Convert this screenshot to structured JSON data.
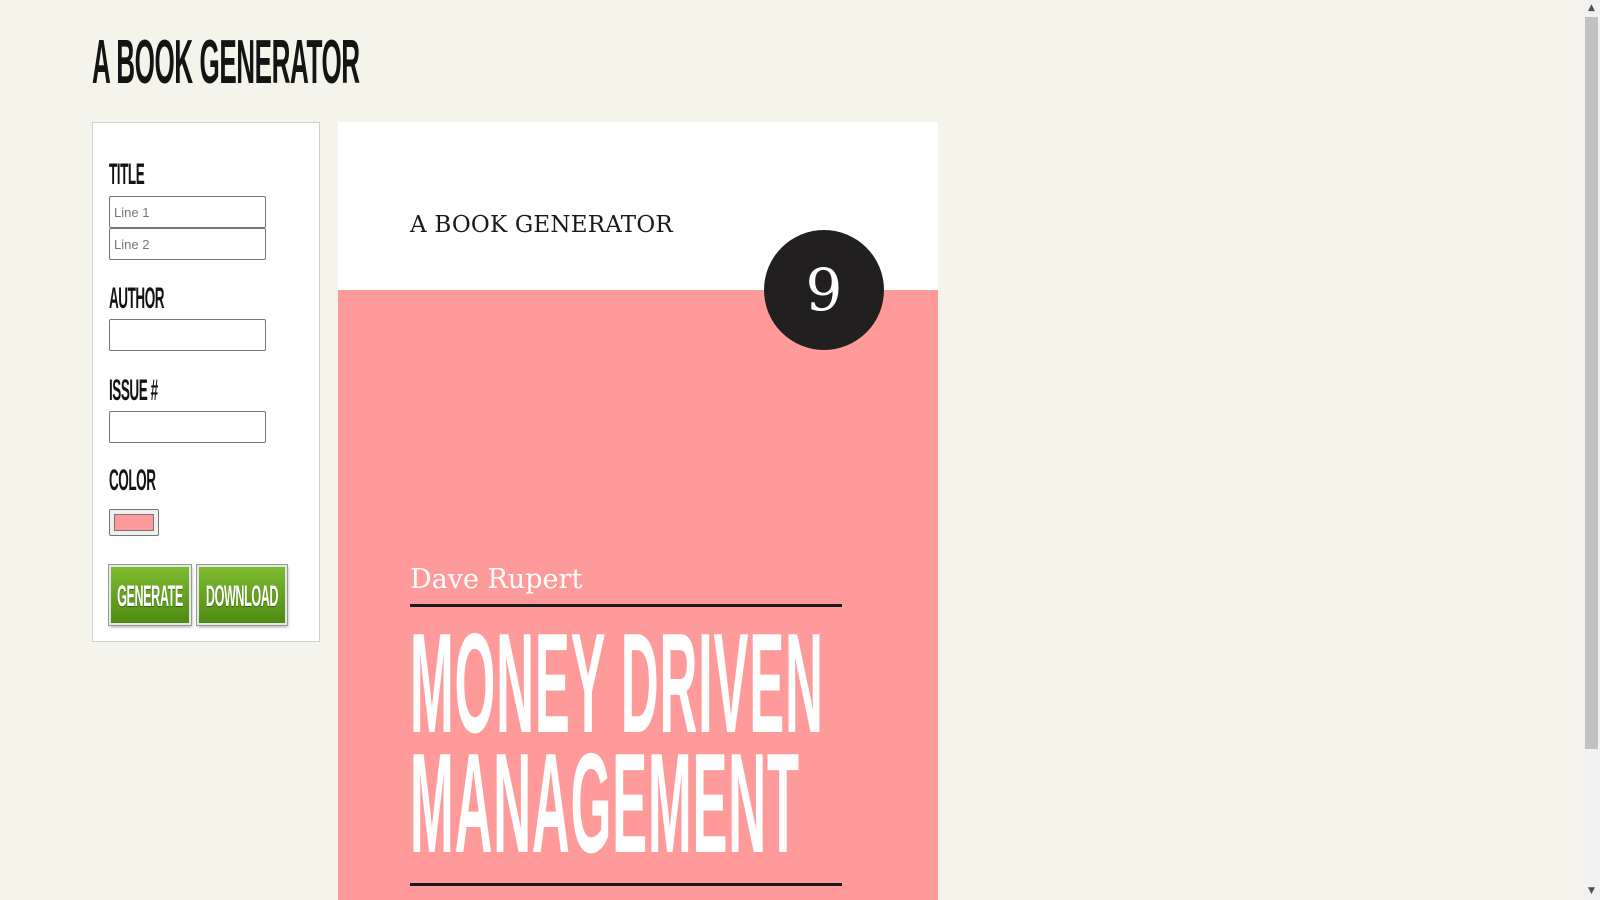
{
  "app": {
    "title": "A BOOK GENERATOR"
  },
  "form": {
    "title_label": "TITLE",
    "title_line1_placeholder": "Line 1",
    "title_line1_value": "",
    "title_line2_placeholder": "Line 2",
    "title_line2_value": "",
    "author_label": "AUTHOR",
    "author_value": "",
    "issue_label": "ISSUE #",
    "issue_value": "",
    "color_label": "COLOR",
    "color_value": "#ff9a9a",
    "generate_label": "GENERATE",
    "download_label": "DOWNLOAD"
  },
  "cover": {
    "series": "A BOOK GENERATOR",
    "issue_number": "9",
    "author": "Dave Rupert",
    "title_line1": "MONEY DRIVEN",
    "title_line2": "MANAGEMENT",
    "colors": {
      "background": "#ff9a9a",
      "header": "#ffffff",
      "badge": "#221f20",
      "rule": "#1a1a1a"
    }
  },
  "theme": {
    "page_background": "#f5f4ea",
    "button_gradient_top": "#7dbb2f",
    "button_gradient_bottom": "#4f8a12"
  }
}
